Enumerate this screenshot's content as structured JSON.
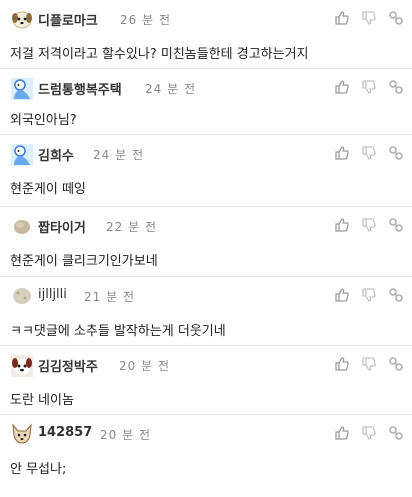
{
  "comments": [
    {
      "nick": "디플로마크",
      "time": "26 분 전",
      "text": "저걸 저격이라고 할수있나? 미친놈들한테 경고하는거지",
      "avatar_icon": "puppy-face-icon"
    },
    {
      "nick": "드럼통행복주택",
      "time": "24 분 전",
      "text": "외국인아님?",
      "avatar_icon": "blue-figure-icon"
    },
    {
      "nick": "김희수",
      "time": "24 분 전",
      "text": "현준게이 떼잉",
      "avatar_icon": "blue-figure-icon"
    },
    {
      "nick": "짭타이거",
      "time": "22 분 전",
      "text": "현준게이 클리크기인가보네",
      "avatar_icon": "round-blob-icon"
    },
    {
      "nick": "ijlljlli",
      "time": "21 분 전",
      "text": "ㅋㅋ댓글에 소추들 발작하는게 더웃기네",
      "avatar_icon": "round-blob-icon"
    },
    {
      "nick": "김김정박주",
      "time": "20 분 전",
      "text": "도란 네이놈",
      "avatar_icon": "dog-face-icon"
    },
    {
      "nick": "142857",
      "time": "20 분 전",
      "text": "안 무섭나;",
      "avatar_icon": "fox-face-icon"
    }
  ],
  "colors": {
    "divider": "#e6e6e6",
    "meta": "#8a8a8a",
    "icon": "#9a9a9a"
  }
}
